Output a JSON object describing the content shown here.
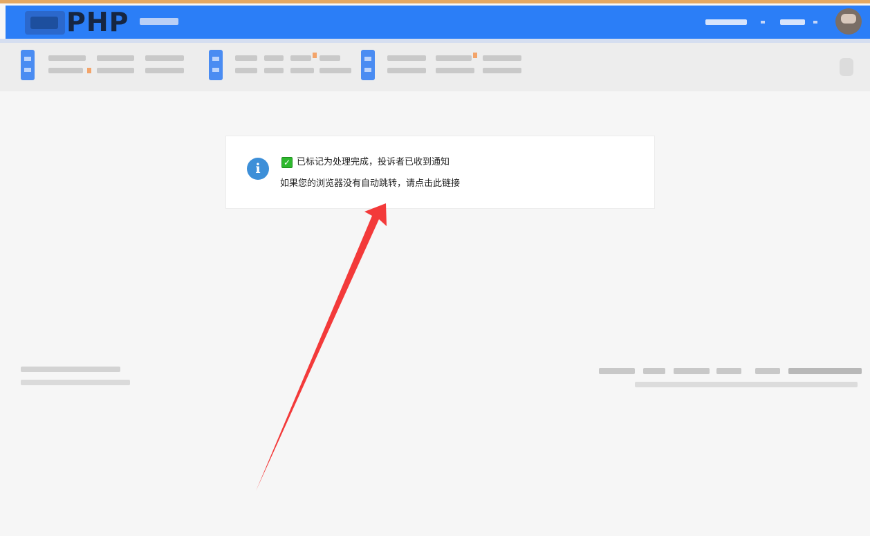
{
  "header": {
    "logo_text": "PHP"
  },
  "notice": {
    "icon": "info-icon",
    "check_icon": "checkbox-check-icon",
    "message": "已标记为处理完成，投诉者已收到通知",
    "redirect_text": "如果您的浏览器没有自动跳转，请点击此链接"
  },
  "annotation": {
    "arrow_color": "#f33a3a"
  },
  "colors": {
    "header_bg": "#2b7ef7",
    "top_line": "#e3a863",
    "info_icon": "#3d8fd8",
    "check_green": "#2eb82e"
  }
}
